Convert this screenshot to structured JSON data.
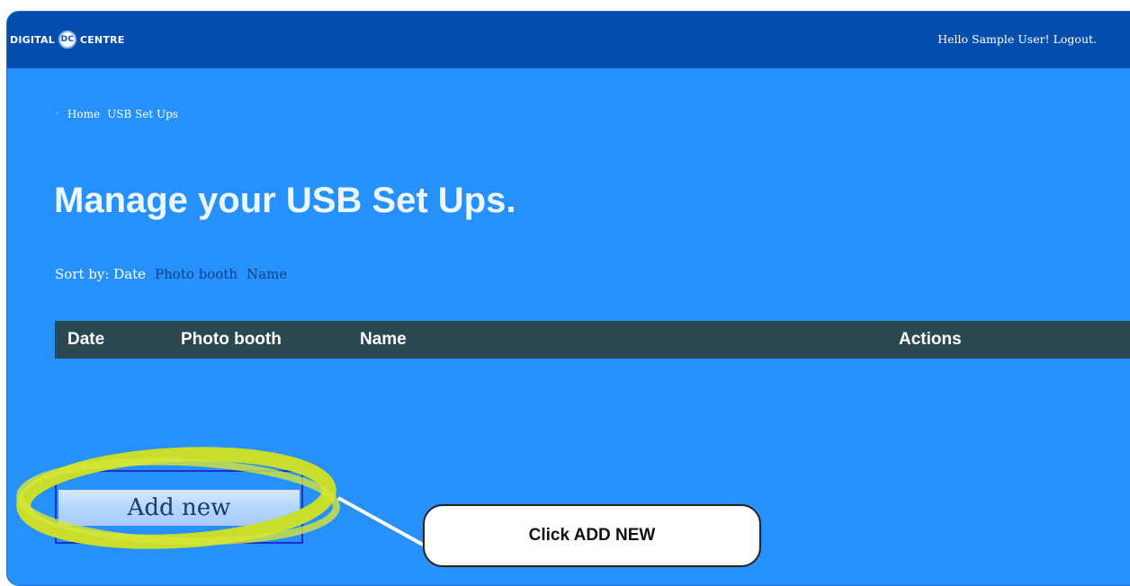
{
  "header": {
    "logo_left": "DIGITAL",
    "logo_badge": "DC",
    "logo_right": "CENTRE",
    "greeting": "Hello Sample User! Logout."
  },
  "breadcrumb": [
    "Home",
    "USB Set Ups"
  ],
  "page": {
    "title": "Manage your USB Set Ups."
  },
  "sort": {
    "label": "Sort by: Date",
    "links": [
      "Photo booth",
      "Name"
    ]
  },
  "table": {
    "columns": [
      "Date",
      "Photo booth",
      "Name",
      "Actions"
    ],
    "rows": []
  },
  "actions": {
    "add_new": "Add new"
  },
  "annotation": {
    "callout": "Click ADD NEW"
  },
  "colors": {
    "topbar": "#064eae",
    "background": "#2690fb",
    "table_header": "#2b4852",
    "highlight": "#c9de2a"
  }
}
